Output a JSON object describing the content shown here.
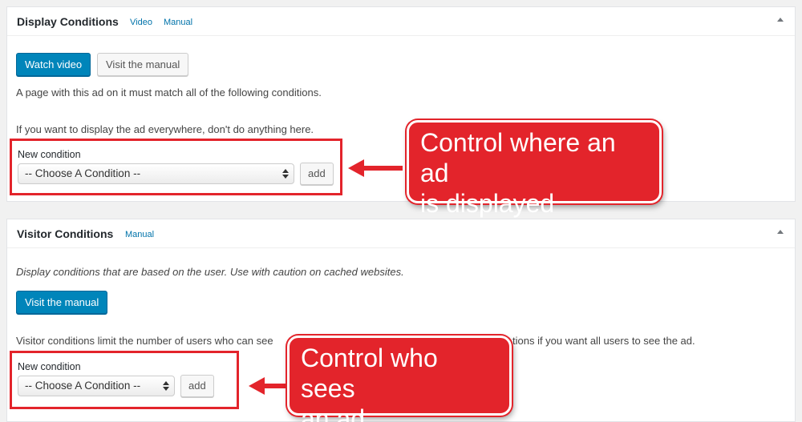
{
  "display": {
    "title": "Display Conditions",
    "video_link": "Video",
    "manual_link": "Manual",
    "watch_video": "Watch video",
    "visit_manual": "Visit the manual",
    "desc1": "A page with this ad on it must match all of the following conditions.",
    "desc2": "If you want to display the ad everywhere, don't do anything here.",
    "new_condition_label": "New condition",
    "select_value": "-- Choose A Condition --",
    "add_label": "add"
  },
  "visitor": {
    "title": "Visitor Conditions",
    "manual_link": "Manual",
    "desc_italic": "Display conditions that are based on the user. Use with caution on cached websites.",
    "visit_manual": "Visit the manual",
    "desc_part1": "Visitor conditions limit the number of users who can see",
    "desc_part2": "tions if you want all users to see the ad.",
    "new_condition_label": "New condition",
    "select_value": "-- Choose A Condition --",
    "add_label": "add"
  },
  "callouts": {
    "display_line1": "Control where an ad",
    "display_line2": "is displayed",
    "visitor_line1": "Control who sees",
    "visitor_line2": "an ad"
  },
  "colors": {
    "primary_button": "#0085ba",
    "link": "#0073aa",
    "annotation_red": "#e3242b"
  }
}
